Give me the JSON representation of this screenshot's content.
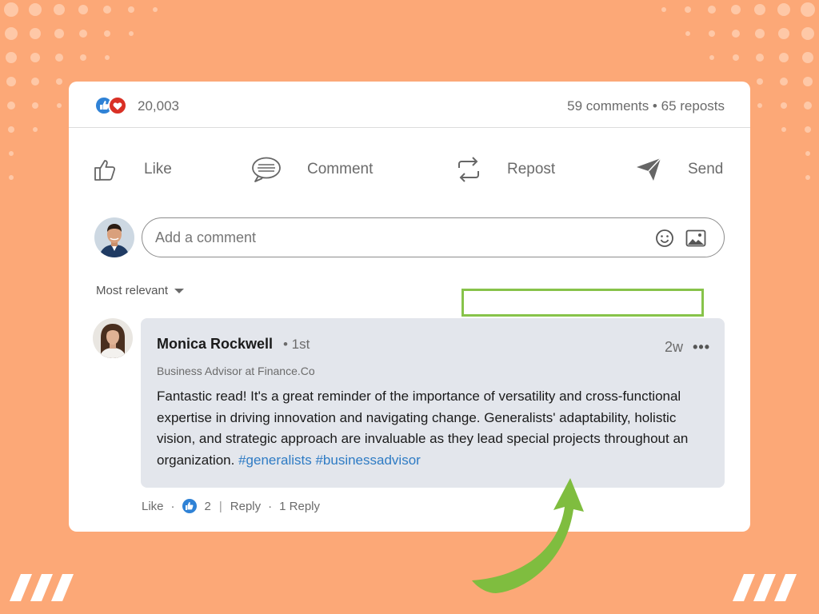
{
  "post_stats": {
    "reaction_count": "20,003",
    "engagement": "59 comments • 65 reposts"
  },
  "actions": {
    "like": "Like",
    "comment": "Comment",
    "repost": "Repost",
    "send": "Send"
  },
  "comment_box": {
    "placeholder": "Add a comment"
  },
  "sort": {
    "label": "Most relevant"
  },
  "comment": {
    "author": "Monica Rockwell",
    "degree": "• 1st",
    "time": "2w",
    "more": "•••",
    "headline": "Business Advisor at Finance.Co",
    "text": "Fantastic read! It's a great reminder of the importance of versatility and cross-functional expertise in driving innovation and navigating change. Generalists' adaptability, holistic vision, and strategic approach are invaluable as they lead special projects throughout an organization.",
    "hashtags": "#generalists #businessadvisor",
    "like_label": "Like",
    "like_count": "2",
    "reply_label": "Reply",
    "replies": "1 Reply"
  },
  "colors": {
    "background": "#fca877",
    "hashtag": "#2e7bc4",
    "highlight": "#87c34a",
    "bubble": "#e3e6ec"
  }
}
